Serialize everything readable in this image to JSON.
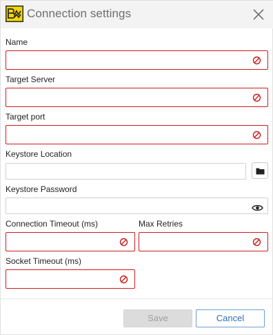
{
  "dialog": {
    "title": "Connection settings",
    "logo_icon": "app-logo-icon",
    "close_icon": "close-icon"
  },
  "fields": {
    "name": {
      "label": "Name",
      "value": ""
    },
    "target_server": {
      "label": "Target Server",
      "value": ""
    },
    "target_port": {
      "label": "Target port",
      "value": ""
    },
    "keystore_location": {
      "label": "Keystore Location",
      "value": ""
    },
    "keystore_password": {
      "label": "Keystore Password",
      "value": ""
    },
    "connection_timeout": {
      "label": "Connection Timeout (ms)",
      "value": ""
    },
    "max_retries": {
      "label": "Max Retries",
      "value": ""
    },
    "socket_timeout": {
      "label": "Socket Timeout (ms)",
      "value": ""
    }
  },
  "icons": {
    "error": "error-icon",
    "folder": "folder-icon",
    "eye": "eye-icon"
  },
  "buttons": {
    "save_label": "Save",
    "cancel_label": "Cancel"
  },
  "colors": {
    "error_border": "#cc1a1a",
    "title_bar": "#f3f3f3",
    "cancel_text": "#2f6fb5",
    "disabled_button": "#dcdcdc",
    "logo_yellow": "#f2d600"
  }
}
